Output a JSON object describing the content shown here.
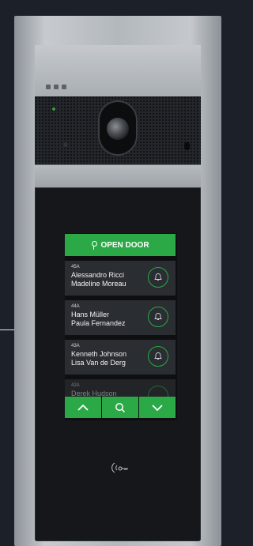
{
  "panel": {
    "open_door_label": "OPEN DOOR",
    "accent_color": "#2aa946",
    "entries": [
      {
        "unit": "45A",
        "line1": "Alessandro Ricci",
        "line2": "Madeline Moreau"
      },
      {
        "unit": "44A",
        "line1": "Hans Müller",
        "line2": "Paula Fernandez"
      },
      {
        "unit": "43A",
        "line1": "Kenneth Johnson",
        "line2": "Lisa Van de Derg"
      },
      {
        "unit": "42A",
        "line1": "Derek Hudson",
        "line2": ""
      }
    ],
    "nav": {
      "up_icon": "chevron-up-icon",
      "search_icon": "search-icon",
      "down_icon": "chevron-down-icon"
    },
    "nfc_icon": "nfc-key-icon"
  }
}
